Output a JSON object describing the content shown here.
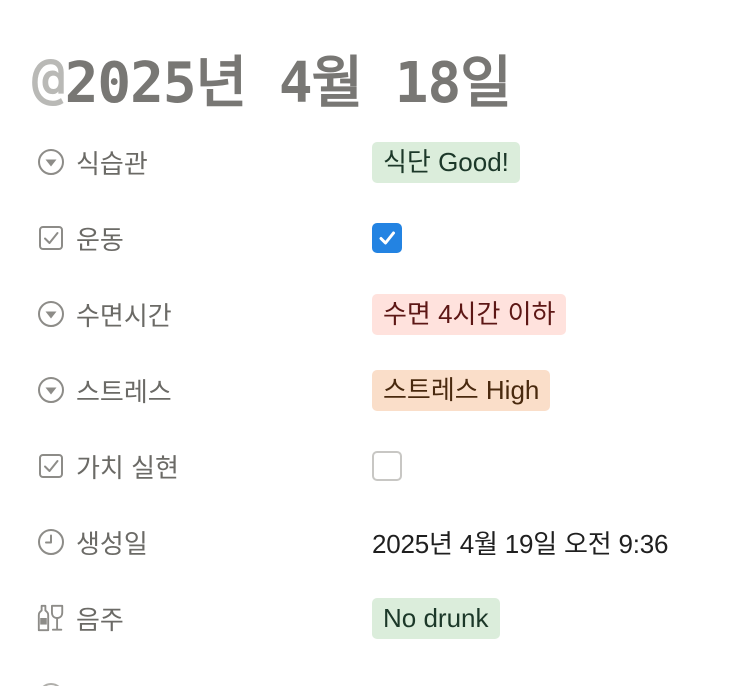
{
  "page": {
    "title_at": "@",
    "title_date": "2025년 4월 18일"
  },
  "properties": [
    {
      "label": "식습관",
      "icon": "select-circle-icon",
      "type": "tag",
      "value": "식단 Good!",
      "tag_bg": "#dbeddb",
      "tag_fg": "#1c3829"
    },
    {
      "label": "운동",
      "icon": "checkbox-property-icon",
      "type": "checkbox",
      "checked": true
    },
    {
      "label": "수면시간",
      "icon": "select-circle-icon",
      "type": "tag",
      "value": "수면 4시간 이하",
      "tag_bg": "#ffe2dd",
      "tag_fg": "#5d1715"
    },
    {
      "label": "스트레스",
      "icon": "select-circle-icon",
      "type": "tag",
      "value": "스트레스 High",
      "tag_bg": "#fadec9",
      "tag_fg": "#49290e"
    },
    {
      "label": "가치 실현",
      "icon": "checkbox-property-icon",
      "type": "checkbox",
      "checked": false
    },
    {
      "label": "생성일",
      "icon": "clock-icon",
      "type": "text",
      "value": "2025년 4월 19일 오전 9:36"
    },
    {
      "label": "음주",
      "icon": "wine-bottle-glass-icon",
      "type": "tag",
      "value": "No drunk",
      "tag_bg": "#dbeddb",
      "tag_fg": "#1c3829"
    }
  ],
  "colors": {
    "label_gray": "#6b6a66",
    "checkbox_blue": "#2383e2"
  }
}
